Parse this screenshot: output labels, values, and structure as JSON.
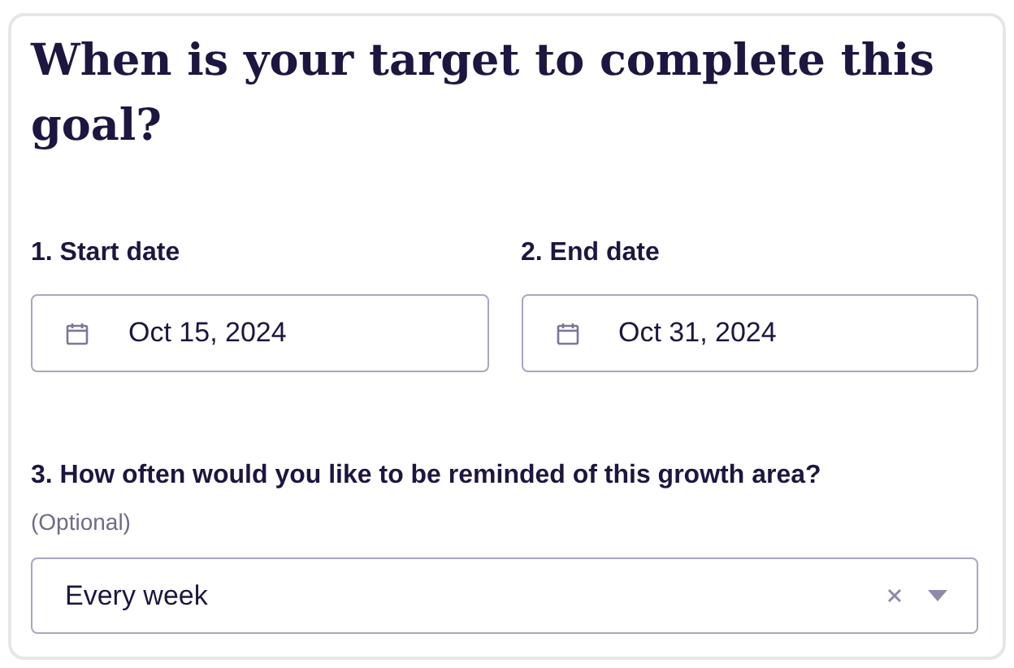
{
  "title": "When is your target to complete this goal?",
  "date_fields": [
    {
      "label": "1. Start date",
      "value": "Oct 15, 2024"
    },
    {
      "label": "2. End date",
      "value": "Oct 31, 2024"
    }
  ],
  "reminder": {
    "label": "3. How often would you like to be reminded of this growth area?",
    "hint": "(Optional)",
    "value": "Every week"
  }
}
